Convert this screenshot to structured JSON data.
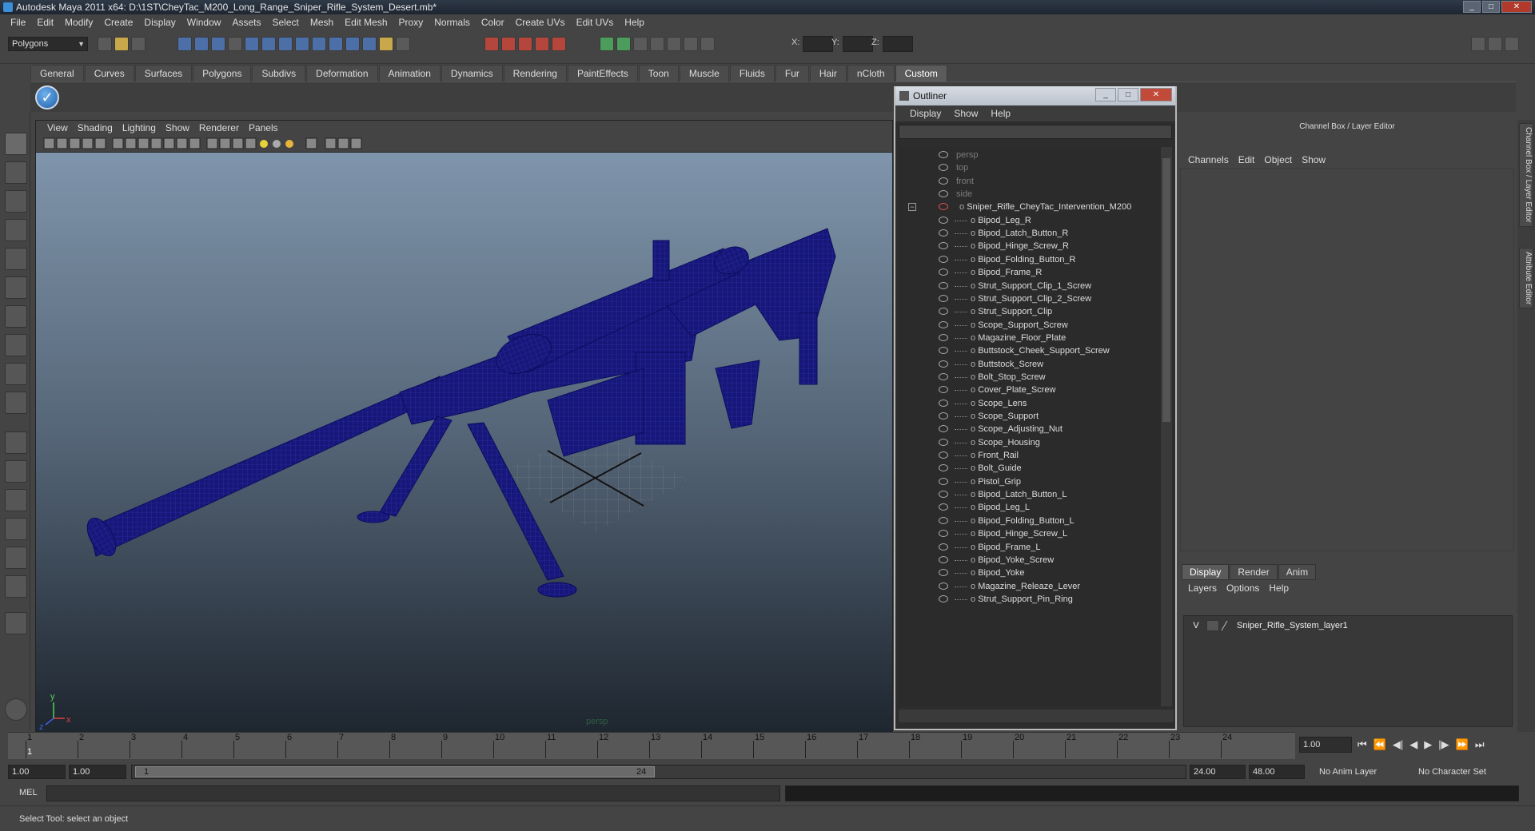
{
  "window": {
    "title": "Autodesk Maya 2011 x64: D:\\1ST\\CheyTac_M200_Long_Range_Sniper_Rifle_System_Desert.mb*"
  },
  "menubar": [
    "File",
    "Edit",
    "Modify",
    "Create",
    "Display",
    "Window",
    "Assets",
    "Select",
    "Mesh",
    "Edit Mesh",
    "Proxy",
    "Normals",
    "Color",
    "Create UVs",
    "Edit UVs",
    "Help"
  ],
  "statusline": {
    "mode_dropdown": "Polygons",
    "x_label": "X:",
    "y_label": "Y:",
    "z_label": "Z:"
  },
  "shelf_tabs": [
    "General",
    "Curves",
    "Surfaces",
    "Polygons",
    "Subdivs",
    "Deformation",
    "Animation",
    "Dynamics",
    "Rendering",
    "PaintEffects",
    "Toon",
    "Muscle",
    "Fluids",
    "Fur",
    "Hair",
    "nCloth",
    "Custom"
  ],
  "shelf_active": "Custom",
  "viewport": {
    "menu": [
      "View",
      "Shading",
      "Lighting",
      "Show",
      "Renderer",
      "Panels"
    ],
    "camera_label": "persp",
    "axis_y": "y",
    "axis_x": "x",
    "axis_z": "z",
    "background_top": "#7f95ab",
    "background_bottom": "#1e262f",
    "wire_color": "#141473"
  },
  "outliner": {
    "title": "Outliner",
    "menu": [
      "Display",
      "Show",
      "Help"
    ],
    "cameras": [
      "persp",
      "top",
      "front",
      "side"
    ],
    "root": "Sniper_Rifle_CheyTac_Intervention_M200",
    "root_expander": "−",
    "children": [
      "Bipod_Leg_R",
      "Bipod_Latch_Button_R",
      "Bipod_Hinge_Screw_R",
      "Bipod_Folding_Button_R",
      "Bipod_Frame_R",
      "Strut_Support_Clip_1_Screw",
      "Strut_Support_Clip_2_Screw",
      "Strut_Support_Clip",
      "Scope_Support_Screw",
      "Magazine_Floor_Plate",
      "Buttstock_Cheek_Support_Screw",
      "Buttstock_Screw",
      "Bolt_Stop_Screw",
      "Cover_Plate_Screw",
      "Scope_Lens",
      "Scope_Support",
      "Scope_Adjusting_Nut",
      "Scope_Housing",
      "Front_Rail",
      "Bolt_Guide",
      "Pistol_Grip",
      "Bipod_Latch_Button_L",
      "Bipod_Leg_L",
      "Bipod_Folding_Button_L",
      "Bipod_Hinge_Screw_L",
      "Bipod_Frame_L",
      "Bipod_Yoke_Screw",
      "Bipod_Yoke",
      "Magazine_Releaze_Lever",
      "Strut_Support_Pin_Ring"
    ]
  },
  "channelbox": {
    "header": "Channel Box / Layer Editor",
    "menu": [
      "Channels",
      "Edit",
      "Object",
      "Show"
    ],
    "layer_tabs": [
      "Display",
      "Render",
      "Anim"
    ],
    "layer_active": "Display",
    "layer_menu": [
      "Layers",
      "Options",
      "Help"
    ],
    "layer": {
      "visible": "V",
      "name": "Sniper_Rifle_System_layer1"
    },
    "side_tabs": [
      "Channel Box / Layer Editor",
      "Attribute Editor"
    ]
  },
  "timeslider": {
    "ticks": [
      "1",
      "2",
      "3",
      "4",
      "5",
      "6",
      "7",
      "8",
      "9",
      "10",
      "11",
      "12",
      "13",
      "14",
      "15",
      "16",
      "17",
      "18",
      "19",
      "20",
      "21",
      "22",
      "23",
      "24"
    ],
    "current_marker": "1",
    "current_frame": "1.00"
  },
  "range": {
    "start": "1.00",
    "anim_start": "1.00",
    "handle_left": "1",
    "handle_right": "24",
    "end": "24.00",
    "anim_end": "48.00",
    "anim_layer": "No Anim Layer",
    "char_set": "No Character Set"
  },
  "cmdline": {
    "label": "MEL"
  },
  "helpline": {
    "text": "Select Tool: select an object"
  }
}
